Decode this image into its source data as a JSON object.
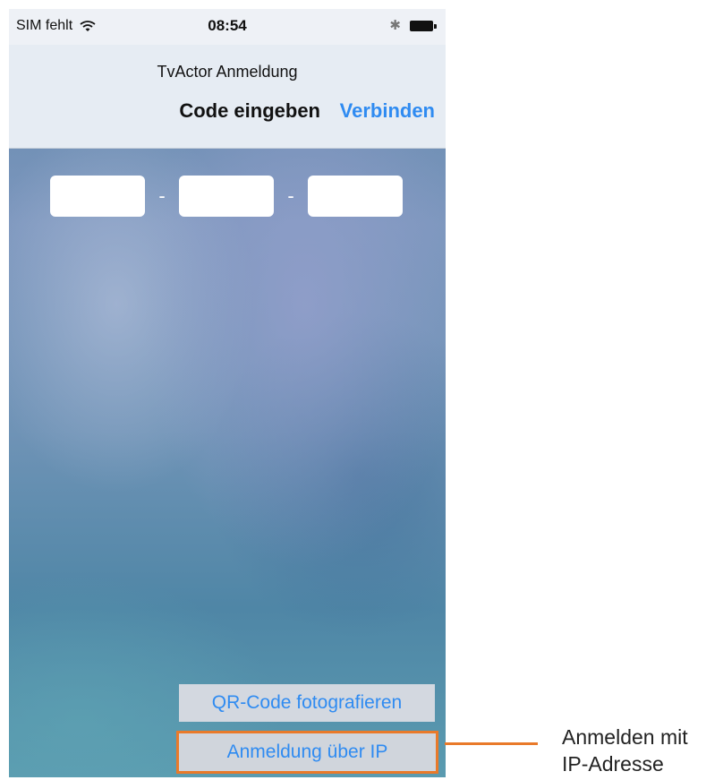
{
  "status_bar": {
    "carrier": "SIM fehlt",
    "time": "08:54",
    "wifi_icon": "wifi-icon",
    "bluetooth_icon": "bluetooth-icon",
    "battery_icon": "battery-icon"
  },
  "nav": {
    "title": "TvActor Anmeldung",
    "subtitle": "Code eingeben",
    "connect_label": "Verbinden"
  },
  "code_input": {
    "part1_value": "",
    "part2_value": "",
    "part3_value": "",
    "separator": "-"
  },
  "buttons": {
    "qr_label": "QR-Code fotografieren",
    "ip_label": "Anmeldung über IP"
  },
  "callout": {
    "line1": "Anmelden mit",
    "line2": "IP-Adresse"
  },
  "colors": {
    "accent": "#2f8bf1",
    "highlight": "#e97a2a"
  }
}
